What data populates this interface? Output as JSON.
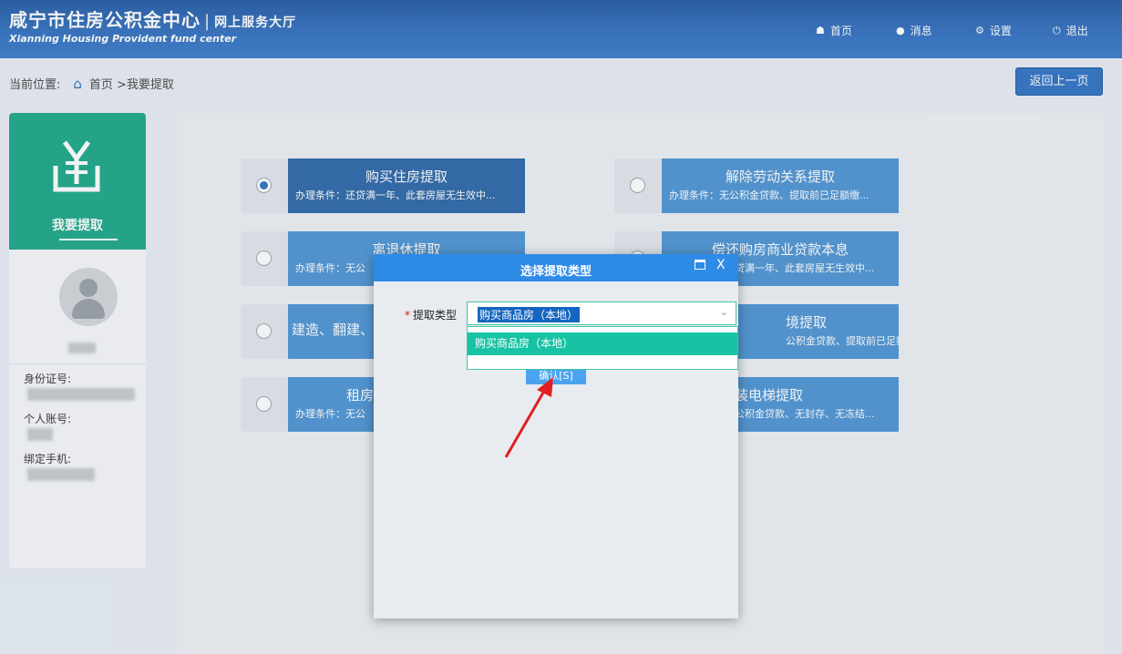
{
  "header": {
    "title": "咸宁市住房公积金中心",
    "separator": "|",
    "subtitle": "网上服务大厅",
    "title_en": "Xianning Housing Provident fund center",
    "nav": [
      {
        "label": "首页",
        "icon": "home-icon"
      },
      {
        "label": "消息",
        "icon": "message-icon"
      },
      {
        "label": "设置",
        "icon": "gear-icon"
      },
      {
        "label": "退出",
        "icon": "power-icon"
      }
    ]
  },
  "breadcrumb": {
    "prefix": "当前位置:",
    "home": "首页",
    "current": ">我要提取"
  },
  "back_button": "返回上一页",
  "sidebar": {
    "title": "我要提取",
    "id_label": "身份证号:",
    "account_label": "个人账号:",
    "phone_label": "绑定手机:"
  },
  "options": [
    {
      "title": "购买住房提取",
      "desc": "办理条件：还贷满一年、此套房屋无生效中..."
    },
    {
      "title": "解除劳动关系提取",
      "desc": "办理条件：无公积金贷款、提取前已足额缴..."
    },
    {
      "title": "离退休提取",
      "desc": "办理条件：无公"
    },
    {
      "title": "偿还购房商业贷款本息",
      "desc": "贷满一年、此套房屋无生效中..."
    },
    {
      "title": "建造、翻建、",
      "desc": ""
    },
    {
      "title": "境提取",
      "desc": "公积金贷款、提取前已足额缴..."
    },
    {
      "title": "租房",
      "desc": "办理条件：无公"
    },
    {
      "title": "装电梯提取",
      "desc": "公积金贷款、无封存、无冻结..."
    }
  ],
  "dialog": {
    "title": "选择提取类型",
    "close": "X",
    "field_required": "*",
    "field_label": "提取类型",
    "selected_value": "购买商品房（本地）",
    "dropdown_items": [
      "购买商品房（本地）"
    ],
    "confirm": "确认[S]"
  },
  "colors": {
    "header": "#2f6bb8",
    "accent_green": "#1ba888",
    "option_blue": "#4d95d4",
    "option_active": "#2c67a8",
    "dialog_head": "#2e8be6",
    "dropdown_highlight": "#17c3a4",
    "arrow": "#e02020"
  }
}
